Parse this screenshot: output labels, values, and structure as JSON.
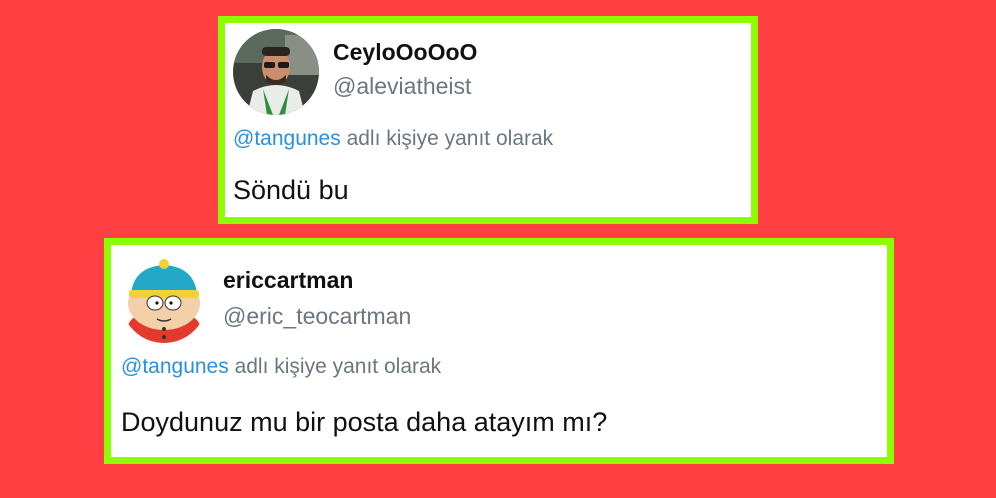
{
  "tweets": [
    {
      "display_name": "CeyloOoOoO",
      "handle": "@aleviatheist",
      "reply_mention": "@tangunes",
      "reply_suffix": " adlı kişiye yanıt olarak",
      "text": "Söndü bu",
      "avatar_icon": "profile-photo-man-in-car"
    },
    {
      "display_name": "ericcartman",
      "handle": "@eric_teocartman",
      "reply_mention": "@tangunes",
      "reply_suffix": " adlı kişiye yanıt olarak",
      "text": "Doydunuz mu bir posta daha atayım mı?",
      "avatar_icon": "profile-photo-cartoon-cartman"
    }
  ],
  "colors": {
    "background": "#ff3f42",
    "card_border": "#8cff00",
    "mention": "#2a8fe0",
    "muted_text": "#6b7680"
  }
}
